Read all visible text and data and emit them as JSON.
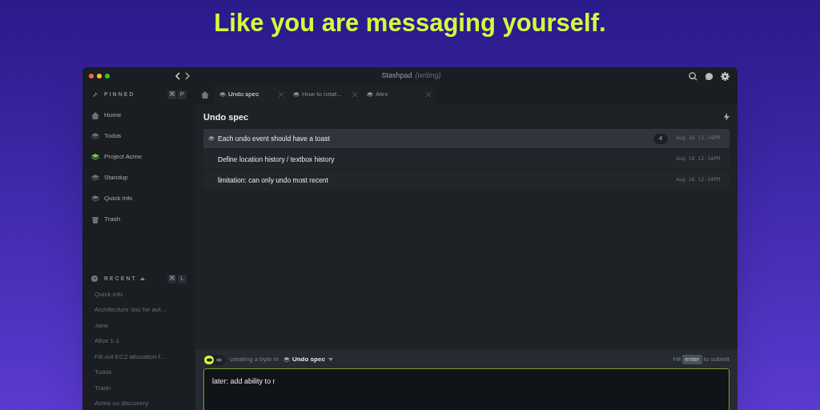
{
  "headline": "Like you are messaging yourself.",
  "window": {
    "title": "Stashpad",
    "subtitle": "(writing)"
  },
  "pinned": {
    "label": "PINNED",
    "shortcut": [
      "⌘",
      "P"
    ],
    "items": [
      {
        "label": "Home",
        "kind": "home",
        "color": "#6b7078"
      },
      {
        "label": "Todos",
        "kind": "stack",
        "color": "#6b7078"
      },
      {
        "label": "Project Acme",
        "kind": "stack",
        "color": "#7cc84a"
      },
      {
        "label": "Standup",
        "kind": "stack",
        "color": "#6b7078"
      },
      {
        "label": "Quick info",
        "kind": "stack",
        "color": "#6b7078"
      },
      {
        "label": "Trash",
        "kind": "trash",
        "color": "#6b7078"
      }
    ]
  },
  "recent": {
    "label": "RECENT",
    "shortcut": [
      "⌘",
      "L"
    ],
    "items": [
      "Quick info",
      "Architecture doc for aut...",
      "Jane",
      "Alice 1-1",
      "Fill out EC2 allocation f...",
      "Todos",
      "Trash",
      "Acme co discovery"
    ]
  },
  "tabs": [
    {
      "kind": "home"
    },
    {
      "kind": "doc",
      "label": "Undo spec",
      "selected": true
    },
    {
      "kind": "doc",
      "label": "How to rotat...",
      "selected": false
    },
    {
      "kind": "doc",
      "label": "Alex",
      "selected": false
    }
  ],
  "doc": {
    "title": "Undo spec",
    "rows": [
      {
        "text": "Each undo event should have a toast",
        "icon": true,
        "count": "4",
        "time": "Aug 16 12:34PM",
        "selected": true
      },
      {
        "text": "Define location history / textbox history",
        "icon": false,
        "time": "Aug 16 12:34PM",
        "selected": false
      },
      {
        "text": "limitation: can only undo most recent",
        "icon": false,
        "time": "Aug 16 12:34PM",
        "selected": false
      }
    ]
  },
  "composer": {
    "mode": [
      {
        "selected": true
      },
      {
        "selected": false
      }
    ],
    "prefix": "creating a byte in",
    "target": "Undo spec",
    "hint": [
      "Hit",
      "enter",
      "to submit"
    ],
    "value": "later: add ability to r"
  }
}
